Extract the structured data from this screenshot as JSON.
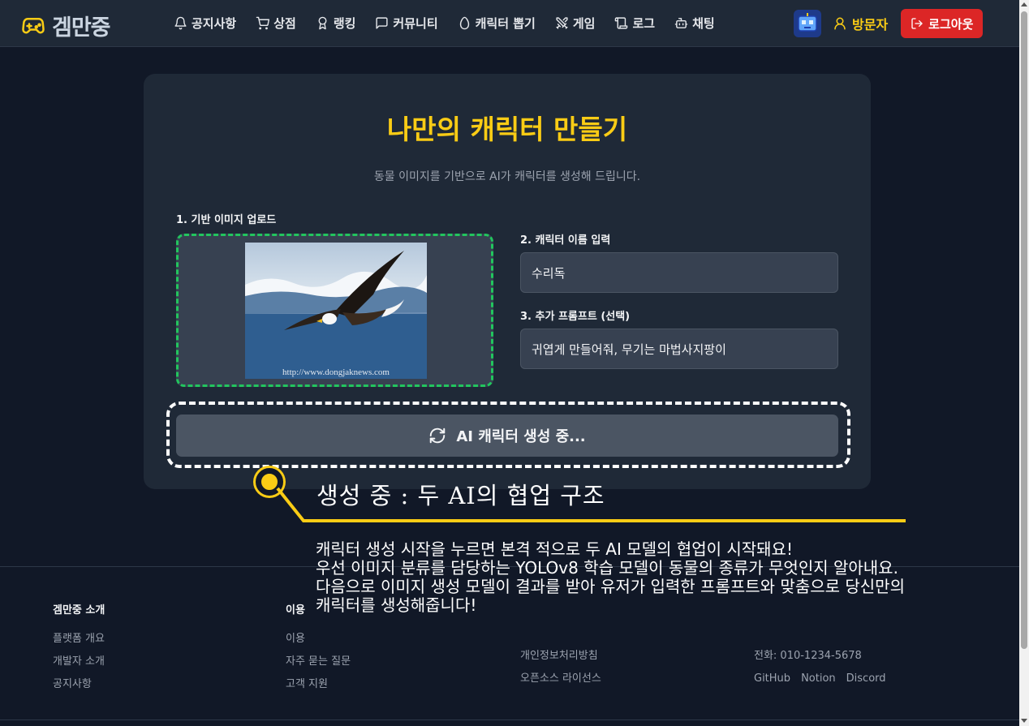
{
  "nav": {
    "logo": "겜만중",
    "menu": [
      {
        "label": "공지사항",
        "icon": "bell-icon"
      },
      {
        "label": "상점",
        "icon": "cart-icon"
      },
      {
        "label": "랭킹",
        "icon": "medal-icon"
      },
      {
        "label": "커뮤니티",
        "icon": "chat-icon"
      },
      {
        "label": "캐릭터 뽑기",
        "icon": "egg-icon"
      },
      {
        "label": "게임",
        "icon": "swords-icon"
      },
      {
        "label": "로그",
        "icon": "scroll-icon"
      },
      {
        "label": "채팅",
        "icon": "bot-icon"
      }
    ],
    "user": "방문자",
    "logout": "로그아웃"
  },
  "card": {
    "title": "나만의 캐릭터 만들기",
    "subtitle": "동물 이미지를 기반으로 AI가 캐릭터를 생성해 드립니다.",
    "upload_label": "1. 기반 이미지 업로드",
    "image_caption": "http://www.dongjaknews.com",
    "name_label": "2. 캐릭터 이름 입력",
    "name_value": "수리독",
    "prompt_label": "3. 추가 프롬프트 (선택)",
    "prompt_value": "귀엽게 만들어줘, 무기는 마법사지팡이",
    "generate_label": "AI 캐릭터 생성 중..."
  },
  "annotation": {
    "title": "생성 중 : 두 AI의 협업 구조",
    "body": "캐릭터 생성 시작을 누르면 본격 적으로 두 AI 모델의 협업이 시작돼요!\n우선 이미지 분류를 담당하는 YOLOv8 학습 모델이 동물의 종류가 무엇인지 알아내요.\n다음으로 이미지 생성 모델이 결과를 받아 유저가 입력한 프롬프트와 맞춤으로 당신만의 캐릭터를 생성해줍니다!"
  },
  "footer": {
    "col1": {
      "head": "겜만중 소개",
      "links": [
        "플랫폼 개요",
        "개발자 소개",
        "공지사항"
      ]
    },
    "col2": {
      "head": "이용",
      "links": [
        "이용",
        "자주 묻는 질문",
        "고객 지원"
      ]
    },
    "col3": {
      "links": [
        "개인정보처리방침",
        "오픈소스 라이선스"
      ]
    },
    "col4": {
      "phone": "전화: 010-1234-5678",
      "social": [
        "GitHub",
        "Notion",
        "Discord"
      ]
    }
  },
  "colors": {
    "accent": "#facc15",
    "danger": "#dc2626",
    "success": "#22c55e",
    "bg": "#111827",
    "panel": "#1f2937"
  }
}
